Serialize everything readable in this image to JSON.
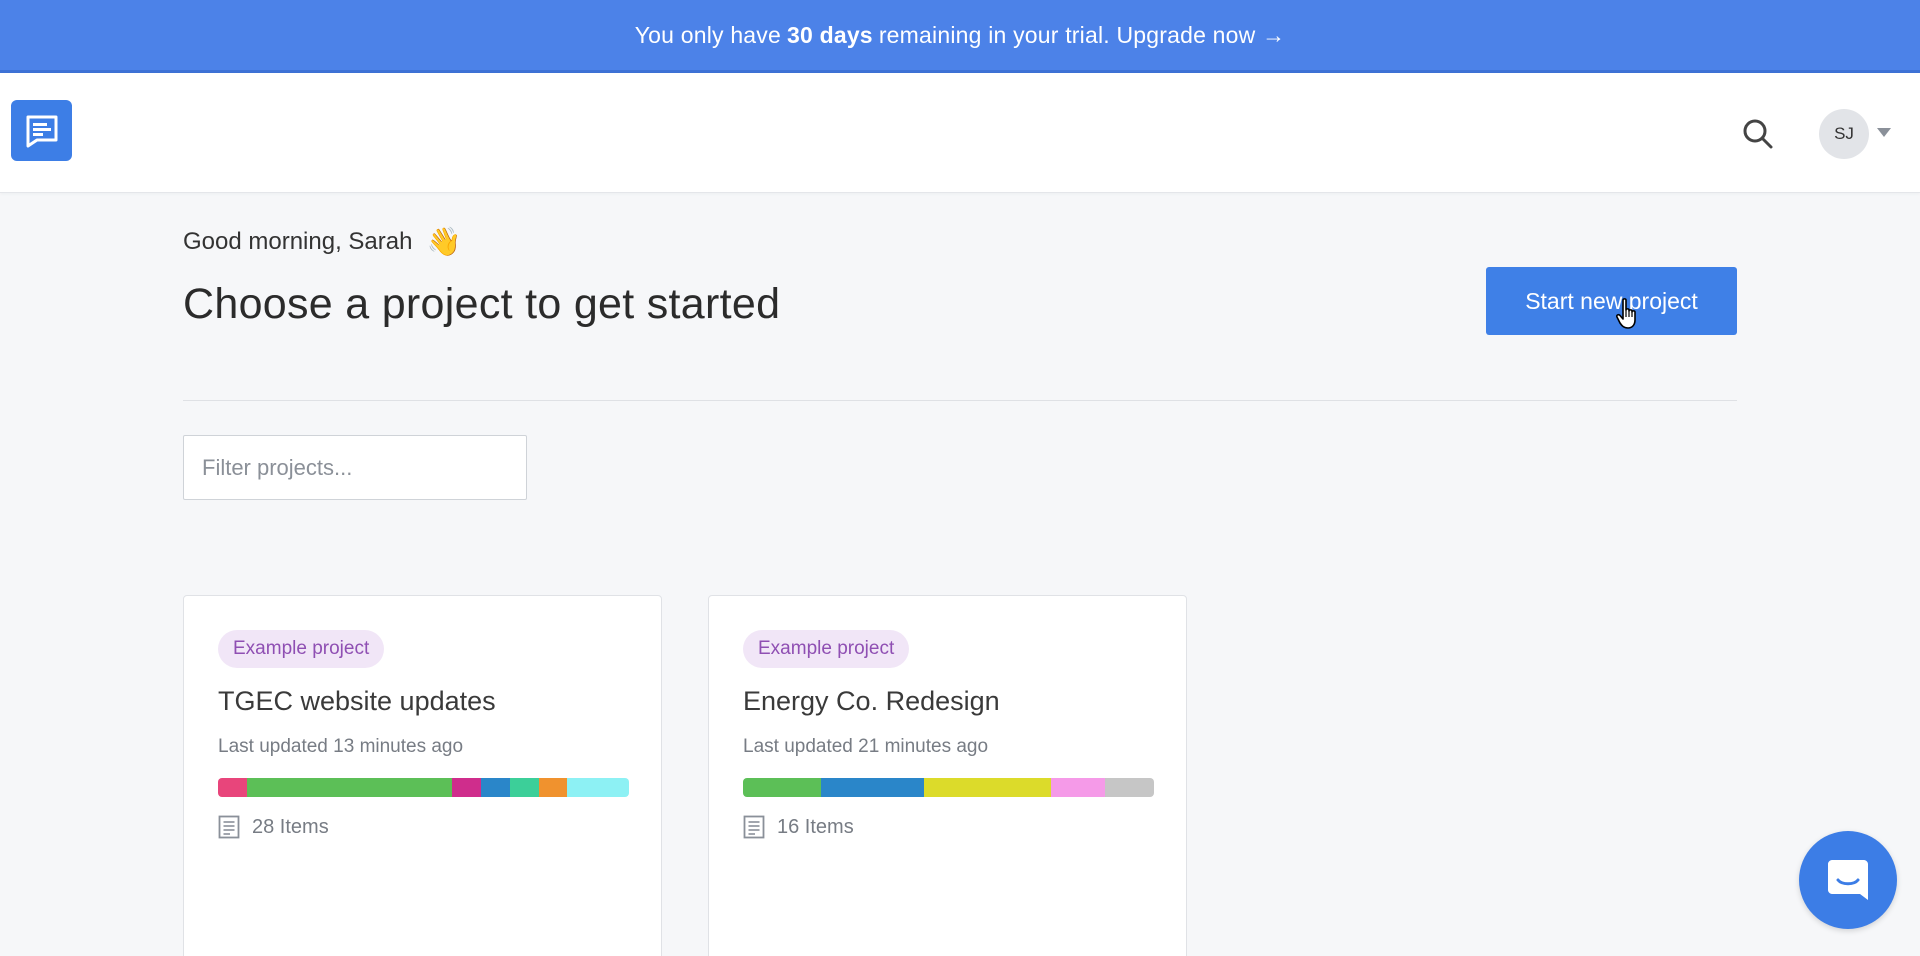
{
  "banner": {
    "prefix": "You only have",
    "days": "30 days",
    "suffix": "remaining in your trial. Upgrade now →"
  },
  "header": {
    "avatar_initials": "SJ"
  },
  "main": {
    "greeting": "Good morning, Sarah",
    "greeting_emoji": "👋",
    "title": "Choose a project to get started",
    "new_project_label": "Start new project",
    "filter_placeholder": "Filter projects..."
  },
  "projects": [
    {
      "badge": "Example project",
      "name": "TGEC website updates",
      "updated": "Last updated 13 minutes ago",
      "items": "28 Items",
      "segments": [
        {
          "color": "#e8457b",
          "share": 0.07
        },
        {
          "color": "#5cbf57",
          "share": 0.5
        },
        {
          "color": "#cf2d8c",
          "share": 0.07
        },
        {
          "color": "#2a86c9",
          "share": 0.07
        },
        {
          "color": "#3ccf99",
          "share": 0.07
        },
        {
          "color": "#f0922e",
          "share": 0.07
        },
        {
          "color": "#8df1f4",
          "share": 0.15
        }
      ]
    },
    {
      "badge": "Example project",
      "name": "Energy Co. Redesign",
      "updated": "Last updated 21 minutes ago",
      "items": "16 Items",
      "segments": [
        {
          "color": "#5cbf57",
          "share": 0.19
        },
        {
          "color": "#2a86c9",
          "share": 0.25
        },
        {
          "color": "#dcdb2a",
          "share": 0.31
        },
        {
          "color": "#f59ae8",
          "share": 0.13
        },
        {
          "color": "#c6c6c6",
          "share": 0.12
        }
      ]
    }
  ],
  "colors": {
    "banner": "#4c82e8",
    "primary": "#3f80e7",
    "badge_bg": "#f1e6f7",
    "badge_text": "#8f4fb3"
  },
  "icons": [
    "app-logo-icon",
    "search-icon",
    "caret-down-icon",
    "pointer-cursor-icon",
    "document-icon",
    "chat-icon"
  ]
}
